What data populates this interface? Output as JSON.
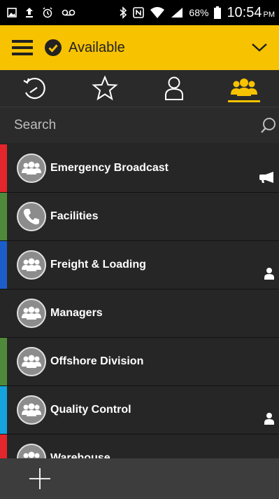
{
  "status_bar": {
    "battery": "68%",
    "time": "10:54",
    "ampm": "PM",
    "icons": [
      "image-icon",
      "upload-icon",
      "alarm-icon",
      "voicemail-icon",
      "bluetooth-icon",
      "nfc-icon",
      "wifi-icon",
      "signal-icon",
      "battery-icon"
    ]
  },
  "app_bar": {
    "status": "Available",
    "accent_color": "#f7c200"
  },
  "tabs": [
    {
      "name": "recents",
      "icon": "history-icon",
      "active": false
    },
    {
      "name": "favorites",
      "icon": "star-icon",
      "active": false
    },
    {
      "name": "contacts",
      "icon": "person-icon",
      "active": false
    },
    {
      "name": "groups",
      "icon": "group-icon",
      "active": true
    }
  ],
  "search": {
    "placeholder": "Search"
  },
  "groups": [
    {
      "label": "Emergency Broadcast",
      "color": "#e3262b",
      "icon": "group-icon",
      "indicator": "megaphone-icon"
    },
    {
      "label": "Facilities",
      "color": "#4f8a3a",
      "icon": "phone-icon",
      "indicator": null
    },
    {
      "label": "Freight & Loading",
      "color": "#1c5ec9",
      "icon": "group-icon",
      "indicator": "person-icon"
    },
    {
      "label": "Managers",
      "color": null,
      "icon": "group-icon",
      "indicator": null
    },
    {
      "label": "Offshore Division",
      "color": "#4f8a3a",
      "icon": "group-icon",
      "indicator": null
    },
    {
      "label": "Quality Control",
      "color": "#15a3dd",
      "icon": "group-icon",
      "indicator": "person-icon"
    },
    {
      "label": "Warehouse",
      "color": "#e3262b",
      "icon": "group-icon",
      "indicator": null
    }
  ],
  "bottom_bar": {
    "add_icon": "plus-icon"
  }
}
